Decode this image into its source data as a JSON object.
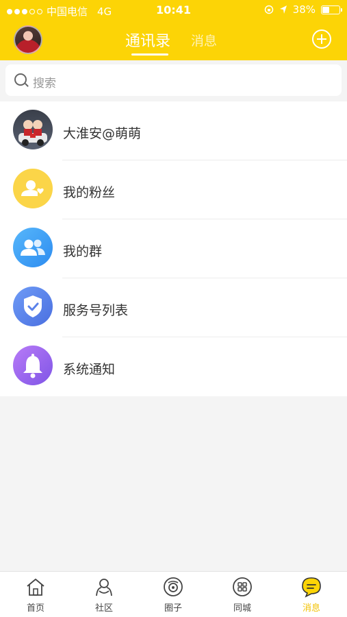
{
  "status_bar": {
    "carrier": "中国电信",
    "network": "4G",
    "time": "10:41",
    "battery": "38%",
    "battery_level": 0.38
  },
  "header": {
    "tabs": [
      {
        "label": "通讯录",
        "active": true
      },
      {
        "label": "消息",
        "active": false
      }
    ]
  },
  "search": {
    "placeholder": "搜索"
  },
  "list": [
    {
      "label": "大淮安@萌萌",
      "icon": "avatar-photo"
    },
    {
      "label": "我的粉丝",
      "icon": "fans-icon",
      "color": "#fbd548"
    },
    {
      "label": "我的群",
      "icon": "group-icon",
      "color": "#2d8cf0"
    },
    {
      "label": "服务号列表",
      "icon": "shield-check-icon",
      "color": "#5b82ea"
    },
    {
      "label": "系统通知",
      "icon": "bell-icon",
      "color": "#9b66ee"
    }
  ],
  "tabbar": [
    {
      "label": "首页",
      "icon": "home-icon"
    },
    {
      "label": "社区",
      "icon": "community-icon"
    },
    {
      "label": "圈子",
      "icon": "circle-icon"
    },
    {
      "label": "同城",
      "icon": "city-icon"
    },
    {
      "label": "消息",
      "icon": "message-icon",
      "active": true
    }
  ],
  "colors": {
    "brand": "#fcd406",
    "active_tab": "#f2c100"
  }
}
